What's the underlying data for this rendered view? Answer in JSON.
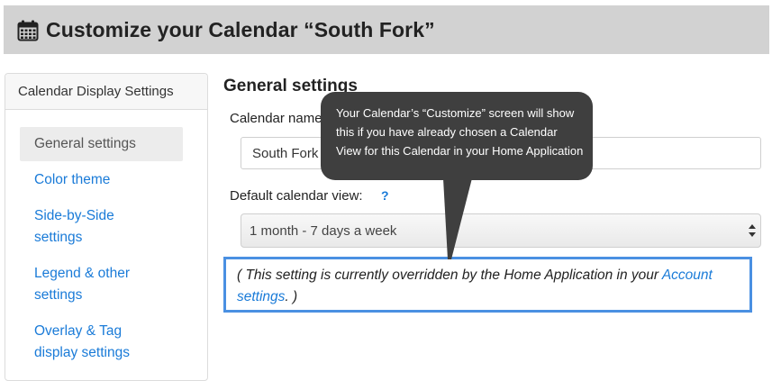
{
  "page": {
    "title": "Customize your Calendar “South Fork”",
    "title_icon": "calendar-icon"
  },
  "sidebar": {
    "header": "Calendar Display Settings",
    "items": [
      {
        "label": "General settings",
        "active": true
      },
      {
        "label": "Color theme",
        "active": false
      },
      {
        "label_lines": [
          "Side-by-Side",
          "settings"
        ],
        "active": false
      },
      {
        "label_lines": [
          "Legend & other",
          "settings"
        ],
        "active": false
      },
      {
        "label_lines": [
          "Overlay & Tag",
          "display settings"
        ],
        "active": false
      }
    ]
  },
  "main": {
    "section_title": "General settings",
    "calendar_name_label": "Calendar name",
    "calendar_name_value": "South Fork",
    "default_view_label": "Default calendar view:",
    "help_icon_text": "?",
    "default_view_value": "1 month - 7 days a week",
    "override_note_prefix": "( This setting is currently overridden by the Home Application in your ",
    "override_note_link": "Account settings",
    "override_note_suffix": ". )"
  },
  "tooltip": {
    "text": "Your Calendar’s “Customize” screen will show this if you have already chosen a Calendar View for this Calendar in your Home Application"
  },
  "colors": {
    "link": "#1a7bd8",
    "highlight_border": "#4a90e2",
    "tooltip_bg": "#3f3f3f",
    "header_bg": "#d2d2d2"
  }
}
